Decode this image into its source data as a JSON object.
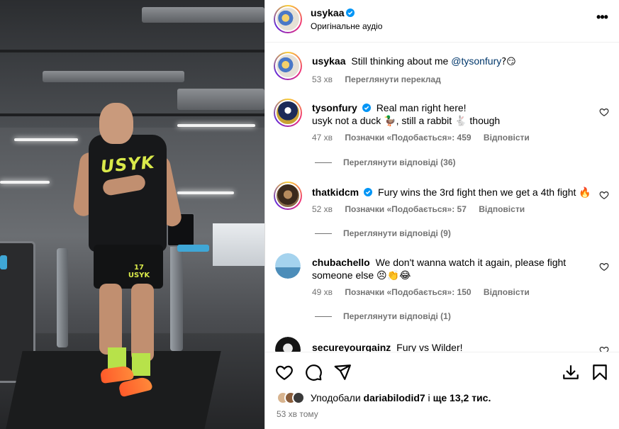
{
  "media": {
    "shirt_text": "USYK",
    "shorts_text": "17 USYK"
  },
  "header": {
    "username": "usykaa",
    "audio": "Оригінальне аудіо",
    "more_label": "•••"
  },
  "caption": {
    "username": "usykaa",
    "text": "Still thinking about me ",
    "mention": "@tysonfury",
    "suffix": "?😏",
    "time": "53 хв",
    "translate": "Переглянути переклад"
  },
  "comments": [
    {
      "username": "tysonfury",
      "verified": true,
      "line1": "Real man right here!",
      "line2": "usyk not a duck 🦆, still a rabbit 🐇 though",
      "time": "47 хв",
      "likes": "Позначки «Подобається»: 459",
      "reply": "Відповісти",
      "view_replies": "Переглянути відповіді (36)"
    },
    {
      "username": "thatkidcm",
      "verified": true,
      "line1": "Fury wins the 3rd fight then we get a 4th fight 🔥",
      "time": "52 хв",
      "likes": "Позначки «Подобається»: 57",
      "reply": "Відповісти",
      "view_replies": "Переглянути відповіді (9)"
    },
    {
      "username": "chubachello",
      "verified": false,
      "line1": "We don't wanna watch it again, please fight",
      "line2": "someone else 😣👏😂",
      "time": "49 хв",
      "likes": "Позначки «Подобається»: 150",
      "reply": "Відповісти",
      "view_replies": "Переглянути відповіді (1)"
    },
    {
      "username": "secureyourgainz",
      "verified": false,
      "line1": "Fury vs Wilder!"
    }
  ],
  "footer": {
    "liked_by_prefix": "Уподобали ",
    "liked_by_user": "dariabilodid7",
    "liked_by_suffix": " і ",
    "liked_by_count": "ще 13,2 тис.",
    "timestamp": "53 хв тому"
  },
  "colors": {
    "verified": "#0095f6",
    "secondary_text": "#737373",
    "mention": "#00376b",
    "divider": "#dbdbdb"
  },
  "icons": [
    "heart-icon",
    "comment-icon",
    "share-icon",
    "download-icon",
    "bookmark-icon",
    "more-icon",
    "verified-icon"
  ]
}
